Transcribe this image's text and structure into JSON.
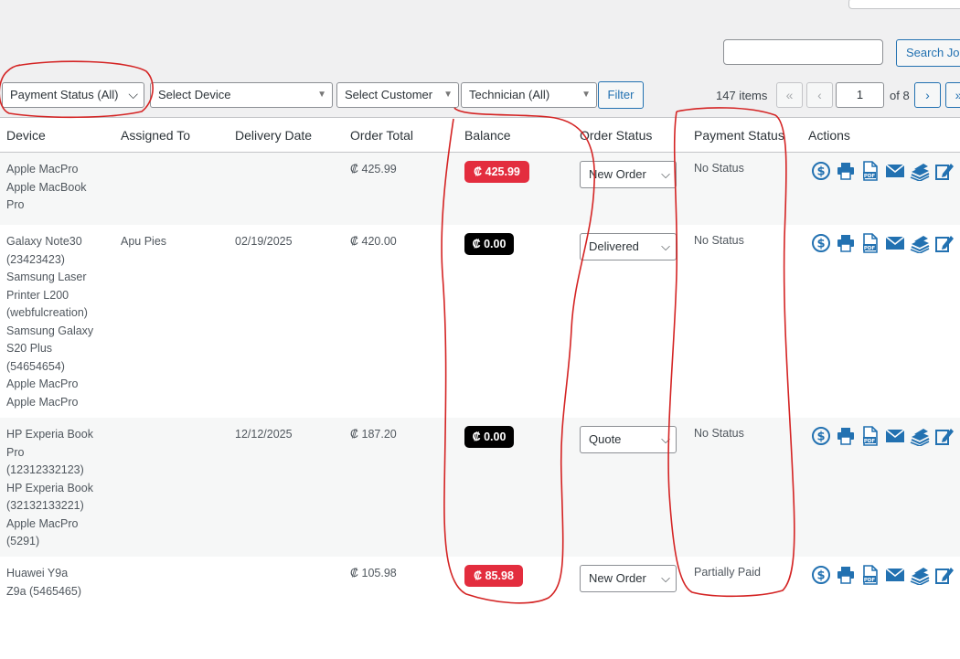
{
  "toolbar": {
    "search_value": "",
    "search_button": "Search Job",
    "filters": {
      "payment_status": "Payment Status (All)",
      "device": "Select Device",
      "customer": "Select Customer",
      "technician": "Technician (All)",
      "filter_button": "Filter"
    },
    "pagination": {
      "items_count": "147 items",
      "first": "«",
      "prev": "‹",
      "current_page": "1",
      "of_pages": "of 8",
      "next": "›",
      "last": "»"
    }
  },
  "table": {
    "headers": [
      "Device",
      "Assigned To",
      "Delivery Date",
      "Order Total",
      "Balance",
      "Order Status",
      "Payment Status",
      "Actions"
    ],
    "rows": [
      {
        "device_lines": [
          "Apple MacPro",
          "Apple MacBook",
          "Pro"
        ],
        "assigned_to": "",
        "delivery_date": "",
        "order_total": "₡ 425.99",
        "balance": "₡ 425.99",
        "balance_color": "#e32d3e",
        "order_status": "New Order",
        "payment_status": "No Status"
      },
      {
        "device_lines": [
          "Galaxy Note30",
          "(23423423)",
          "Samsung Laser",
          "Printer L200",
          "(webfulcreation)",
          "Samsung Galaxy",
          "S20 Plus",
          "(54654654)",
          "Apple MacPro",
          "Apple MacPro"
        ],
        "assigned_to": "Apu Pies",
        "delivery_date": "02/19/2025",
        "order_total": "₡ 420.00",
        "balance": "₡ 0.00",
        "balance_color": "#000000",
        "order_status": "Delivered",
        "payment_status": "No Status"
      },
      {
        "device_lines": [
          "HP Experia Book",
          "Pro",
          "(12312332123)",
          "HP Experia Book",
          "(32132133221)",
          "Apple MacPro",
          "(5291)"
        ],
        "assigned_to": "",
        "delivery_date": "12/12/2025",
        "order_total": "₡ 187.20",
        "balance": "₡ 0.00",
        "balance_color": "#000000",
        "order_status": "Quote",
        "payment_status": "No Status"
      },
      {
        "device_lines": [
          "Huawei Y9a",
          "Z9a (5465465)"
        ],
        "assigned_to": "",
        "delivery_date": "",
        "order_total": "₡ 105.98",
        "balance": "₡ 85.98",
        "balance_color": "#e32d3e",
        "order_status": "New Order",
        "payment_status": "Partially Paid"
      }
    ],
    "action_icons": [
      "dollar-icon",
      "printer-icon",
      "pdf-icon",
      "email-icon",
      "stack-icon",
      "edit-icon"
    ]
  },
  "colors": {
    "accent": "#2271b1",
    "annotation": "#d42424",
    "badge_red": "#e32d3e",
    "badge_black": "#000000"
  }
}
